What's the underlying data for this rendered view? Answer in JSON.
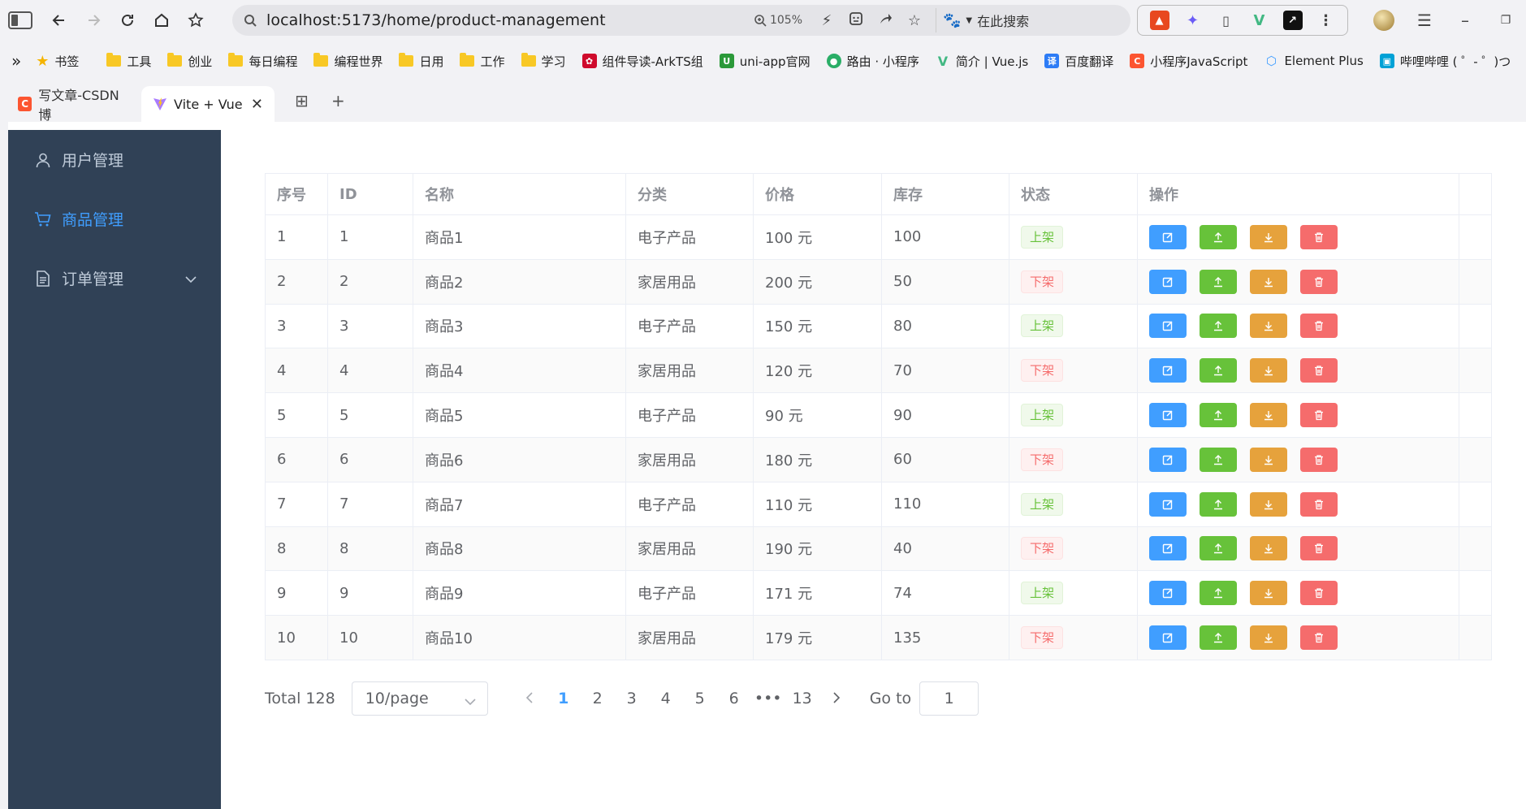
{
  "browser": {
    "url": "localhost:5173/home/product-management",
    "zoom": "105%",
    "search_placeholder": "在此搜索",
    "tabs": [
      {
        "label": "写文章-CSDN博",
        "active": false
      },
      {
        "label": "Vite + Vue",
        "active": true
      }
    ],
    "bookmarks": [
      {
        "label": "书签",
        "icon": "star-icon"
      },
      {
        "label": "工具",
        "icon": "folder-icon"
      },
      {
        "label": "创业",
        "icon": "folder-icon"
      },
      {
        "label": "每日编程",
        "icon": "folder-icon"
      },
      {
        "label": "编程世界",
        "icon": "folder-icon"
      },
      {
        "label": "日用",
        "icon": "folder-icon"
      },
      {
        "label": "工作",
        "icon": "folder-icon"
      },
      {
        "label": "学习",
        "icon": "folder-icon"
      },
      {
        "label": "组件导读-ArkTS组",
        "icon": "huawei-icon"
      },
      {
        "label": "uni-app官网",
        "icon": "uniapp-icon"
      },
      {
        "label": "路由 · 小程序",
        "icon": "wechat-icon"
      },
      {
        "label": "简介 | Vue.js",
        "icon": "vue-icon"
      },
      {
        "label": "百度翻译",
        "icon": "translate-icon"
      },
      {
        "label": "小程序JavaScript",
        "icon": "csdn-icon"
      },
      {
        "label": "Element Plus",
        "icon": "element-icon"
      },
      {
        "label": "哔哩哔哩 ( ゜- ゜)つ",
        "icon": "bilibili-icon"
      }
    ]
  },
  "menu": [
    {
      "label": "用户管理",
      "icon": "user-icon",
      "active": false
    },
    {
      "label": "商品管理",
      "icon": "cart-icon",
      "active": true
    },
    {
      "label": "订单管理",
      "icon": "document-icon",
      "active": false,
      "has_submenu": true
    }
  ],
  "table": {
    "columns": [
      "序号",
      "ID",
      "名称",
      "分类",
      "价格",
      "库存",
      "状态",
      "操作"
    ],
    "rows": [
      {
        "index": "1",
        "id": "1",
        "name": "商品1",
        "category": "电子产品",
        "price": "100 元",
        "stock": "100",
        "status": "上架",
        "on": true
      },
      {
        "index": "2",
        "id": "2",
        "name": "商品2",
        "category": "家居用品",
        "price": "200 元",
        "stock": "50",
        "status": "下架",
        "on": false
      },
      {
        "index": "3",
        "id": "3",
        "name": "商品3",
        "category": "电子产品",
        "price": "150 元",
        "stock": "80",
        "status": "上架",
        "on": true
      },
      {
        "index": "4",
        "id": "4",
        "name": "商品4",
        "category": "家居用品",
        "price": "120 元",
        "stock": "70",
        "status": "下架",
        "on": false
      },
      {
        "index": "5",
        "id": "5",
        "name": "商品5",
        "category": "电子产品",
        "price": "90 元",
        "stock": "90",
        "status": "上架",
        "on": true
      },
      {
        "index": "6",
        "id": "6",
        "name": "商品6",
        "category": "家居用品",
        "price": "180 元",
        "stock": "60",
        "status": "下架",
        "on": false
      },
      {
        "index": "7",
        "id": "7",
        "name": "商品7",
        "category": "电子产品",
        "price": "110 元",
        "stock": "110",
        "status": "上架",
        "on": true
      },
      {
        "index": "8",
        "id": "8",
        "name": "商品8",
        "category": "家居用品",
        "price": "190 元",
        "stock": "40",
        "status": "下架",
        "on": false
      },
      {
        "index": "9",
        "id": "9",
        "name": "商品9",
        "category": "电子产品",
        "price": "171 元",
        "stock": "74",
        "status": "上架",
        "on": true
      },
      {
        "index": "10",
        "id": "10",
        "name": "商品10",
        "category": "家居用品",
        "price": "179 元",
        "stock": "135",
        "status": "下架",
        "on": false
      }
    ],
    "action_icons": [
      "edit-icon",
      "upload-icon",
      "download-icon",
      "delete-icon"
    ]
  },
  "pagination": {
    "total_label": "Total 128",
    "page_size": "10/page",
    "pages": [
      "1",
      "2",
      "3",
      "4",
      "5",
      "6",
      "•••",
      "13"
    ],
    "current_page": "1",
    "goto_label": "Go to",
    "goto_value": "1"
  },
  "colors": {
    "sidebar_bg": "#304156",
    "active": "#409eff",
    "success": "#67c23a",
    "warning": "#e6a23c",
    "danger": "#f56c6c"
  }
}
